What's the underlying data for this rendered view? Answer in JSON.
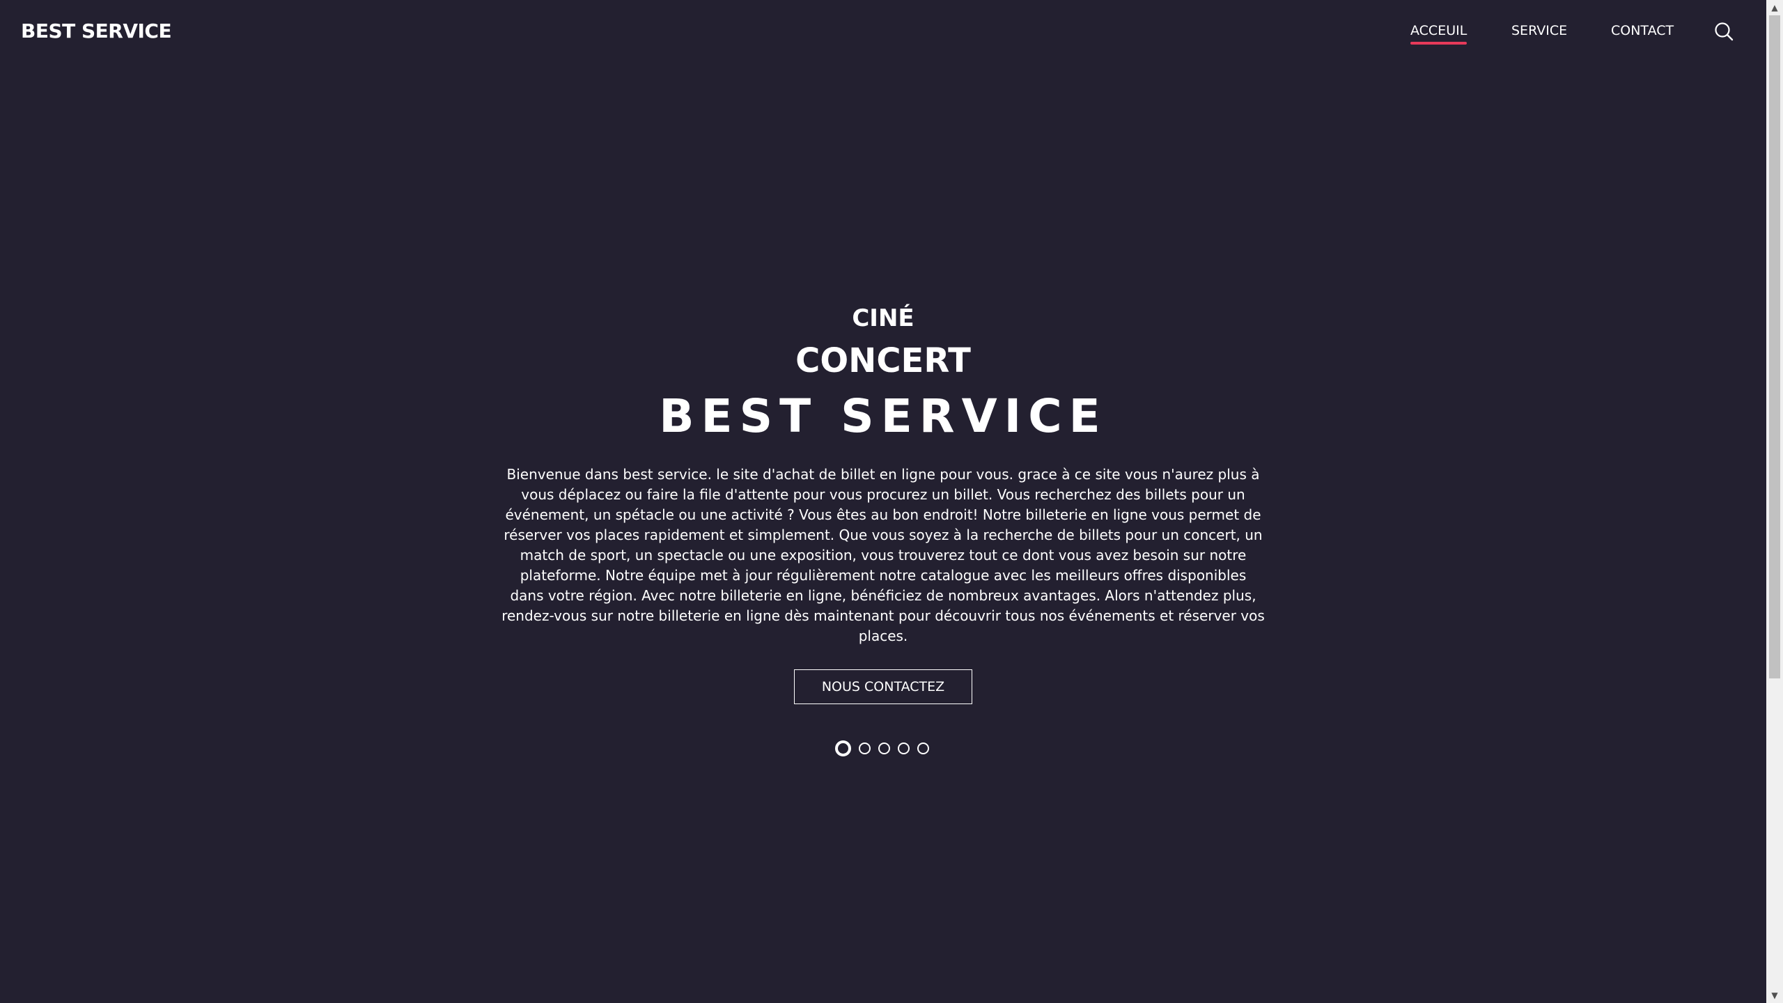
{
  "header": {
    "logo": "BEST SERVICE",
    "nav": [
      {
        "label": "ACCEUIL",
        "active": true
      },
      {
        "label": "SERVICE",
        "active": false
      },
      {
        "label": "CONTACT",
        "active": false
      }
    ],
    "search_icon": "search-icon"
  },
  "hero": {
    "kicker_1": "CINÉ",
    "kicker_2": "CONCERT",
    "title": "BEST SERVICE",
    "text": "Bienvenue dans best service. le site d'achat de billet en ligne pour vous. grace à ce site vous n'aurez plus à vous déplacez ou faire la file d'attente pour vous procurez un billet. Vous recherchez des billets pour un événement, un spétacle ou une activité ? Vous êtes au bon endroit! Notre billeterie en ligne vous permet de réserver vos places rapidement et simplement. Que vous soyez à la recherche de billets pour un concert, un match de sport, un spectacle ou une exposition, vous trouverez tout ce dont vous avez besoin sur notre plateforme. Notre équipe met à jour régulièrement notre catalogue avec les meilleurs offres disponibles dans votre région. Avec notre billeterie en ligne, bénéficiez de nombreux avantages. Alors n'attendez plus, rendez-vous sur notre billeterie en ligne dès maintenant pour découvrir tous nos événements et réserver vos places.",
    "cta_label": "NOUS CONTACTEZ",
    "slides_total": 5,
    "slide_active": 1
  },
  "colors": {
    "background": "#232030",
    "text": "#ffffff",
    "accent": "#e63a5a"
  },
  "scrollbar": {
    "up_arrow": "▲",
    "down_arrow": "▼"
  }
}
